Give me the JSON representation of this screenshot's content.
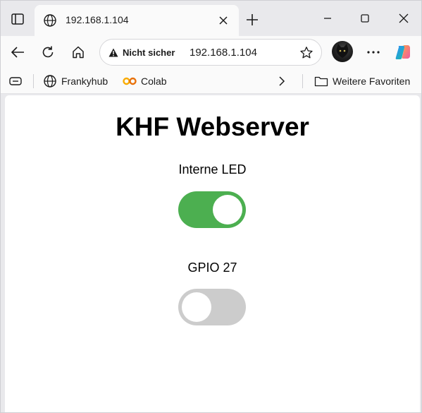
{
  "browser": {
    "tab": {
      "title": "192.168.1.104"
    },
    "address_bar": {
      "security_label": "Nicht sicher",
      "url": "192.168.1.104"
    },
    "favorites": [
      {
        "label": "Frankyhub",
        "icon": "globe-icon"
      },
      {
        "label": "Colab",
        "icon": "colab-icon"
      }
    ],
    "more_favorites_label": "Weitere Favoriten"
  },
  "page": {
    "title": "KHF Webserver",
    "switches": [
      {
        "label": "Interne LED",
        "on": true
      },
      {
        "label": "GPIO 27",
        "on": false
      }
    ]
  },
  "colors": {
    "switch_on": "#4caf50",
    "switch_off": "#cccccc",
    "colab_orange": "#f9ab00"
  }
}
